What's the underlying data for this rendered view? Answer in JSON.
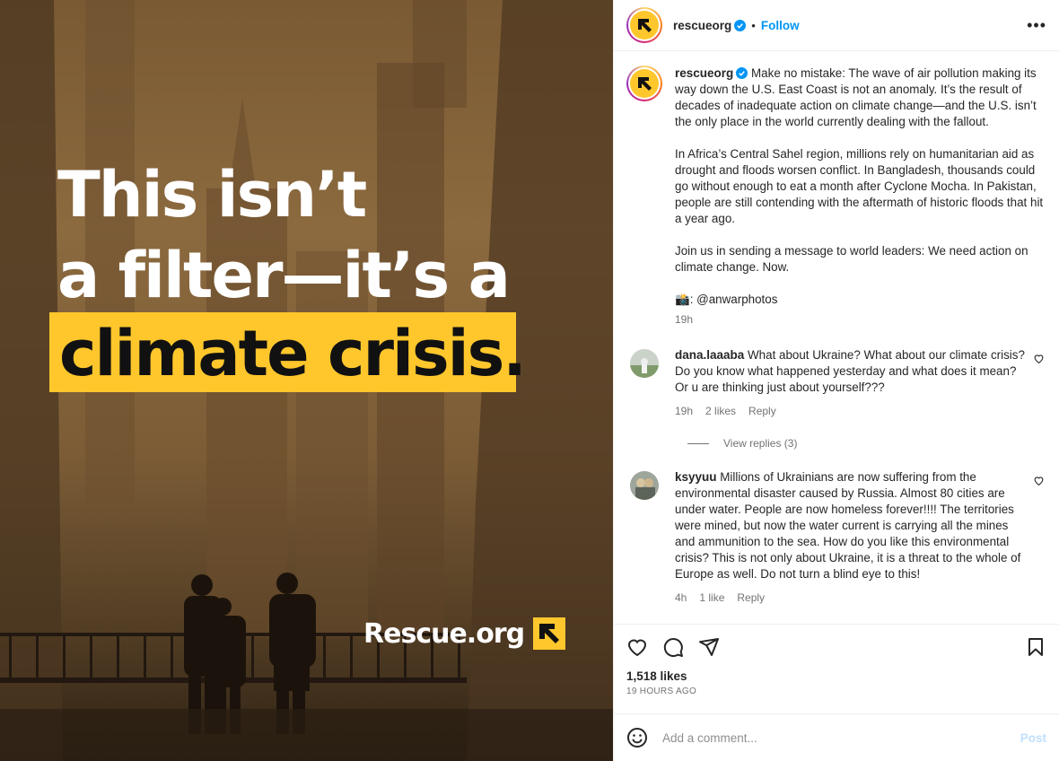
{
  "image": {
    "headline_line1": "This isn’t",
    "headline_line2": "a filter—it’s a",
    "headline_highlight": "climate crisis.",
    "brand": "Rescue.org",
    "highlight_color": "#ffc72c"
  },
  "header": {
    "username": "rescueorg",
    "separator": "•",
    "follow_label": "Follow",
    "more_label": "•••"
  },
  "caption": {
    "username": "rescueorg",
    "paragraph1": "Make no mistake: The wave of air pollution making its way down the U.S. East Coast is not an anomaly. It’s the result of decades of inadequate action on climate change—and the U.S. isn’t the only place in the world currently dealing with the fallout.",
    "paragraph2": "In Africa’s Central Sahel region, millions rely on humanitarian aid as drought and floods worsen conflict. In Bangladesh, thousands could go without enough to eat a month after Cyclone Mocha. In Pakistan, people are still contending with the aftermath of historic floods that hit a year ago.",
    "paragraph3": "Join us in sending a message to world leaders: We need action on climate change. Now.",
    "credit_emoji": "📸",
    "credit": ": @anwarphotos",
    "time": "19h"
  },
  "comments": [
    {
      "username": "dana.laaaba",
      "text": "What about Ukraine? What about our climate crisis? Do you know what happened yesterday and what does it mean? Or u are thinking just about yourself???",
      "time": "19h",
      "likes": "2 likes",
      "reply": "Reply",
      "view_replies": "View replies (3)"
    },
    {
      "username": "ksyyuu",
      "text": "Millions of Ukrainians are now suffering from the environmental disaster caused by Russia. Almost 80 cities are under water. People are now homeless forever!!!! The territories were mined, but now the water current is carrying all the mines and ammunition to the sea. How do you like this environmental crisis? This is not only about Ukraine, it is a threat to the whole of Europe as well. Do not turn a blind eye to this!",
      "time": "4h",
      "likes": "1 like",
      "reply": "Reply"
    }
  ],
  "footer": {
    "likes": "1,518 likes",
    "timestamp": "19 HOURS AGO",
    "comment_placeholder": "Add a comment...",
    "post_label": "Post"
  },
  "colors": {
    "link_blue": "#0095f6",
    "muted": "#737373"
  }
}
